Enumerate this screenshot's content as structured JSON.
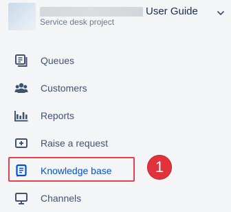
{
  "project": {
    "name": "User Guide",
    "type": "Service desk project"
  },
  "nav": {
    "items": [
      {
        "label": "Queues",
        "icon": "queues-icon"
      },
      {
        "label": "Customers",
        "icon": "customers-icon"
      },
      {
        "label": "Reports",
        "icon": "reports-icon"
      },
      {
        "label": "Raise a request",
        "icon": "raise-request-icon"
      },
      {
        "label": "Knowledge base",
        "icon": "knowledge-base-icon",
        "active": true
      },
      {
        "label": "Channels",
        "icon": "channels-icon"
      }
    ]
  },
  "annotation": {
    "number": "1"
  },
  "colors": {
    "accent": "#0052cc",
    "text": "#42526e",
    "highlight": "#e3414b",
    "callout": "#e2333d",
    "background": "#f4f5f7"
  }
}
